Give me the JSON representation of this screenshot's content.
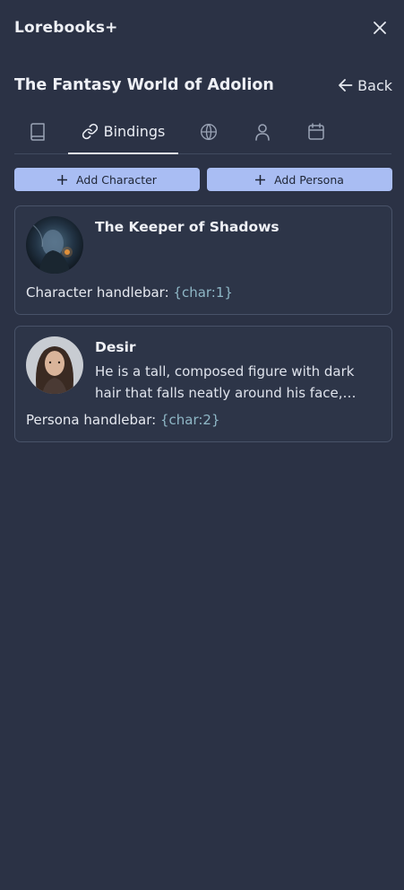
{
  "app": {
    "title": "Lorebooks+"
  },
  "lorebook": {
    "title": "The Fantasy World of Adolion",
    "back_label": "Back"
  },
  "tabs": [
    {
      "icon": "book-icon",
      "label": ""
    },
    {
      "icon": "link-icon",
      "label": "Bindings",
      "active": true
    },
    {
      "icon": "globe-icon",
      "label": ""
    },
    {
      "icon": "user-icon",
      "label": ""
    },
    {
      "icon": "calendar-icon",
      "label": ""
    }
  ],
  "actions": {
    "add_character": "Add Character",
    "add_persona": "Add Persona"
  },
  "bindings": [
    {
      "name": "The Keeper of Shadows",
      "description": "",
      "handle_label": "Character handlebar:",
      "handle_value": "{char:1}"
    },
    {
      "name": "Desir",
      "description": "He is a tall, composed figure with dark hair that falls neatly around his face, hinting at a quiet, reserved nature and a watchful gaze.",
      "handle_label": "Persona handlebar:",
      "handle_value": "{char:2}"
    }
  ],
  "colors": {
    "background": "#2b3245",
    "button": "#a9bdf3",
    "handle_value": "#8fb7c6"
  }
}
